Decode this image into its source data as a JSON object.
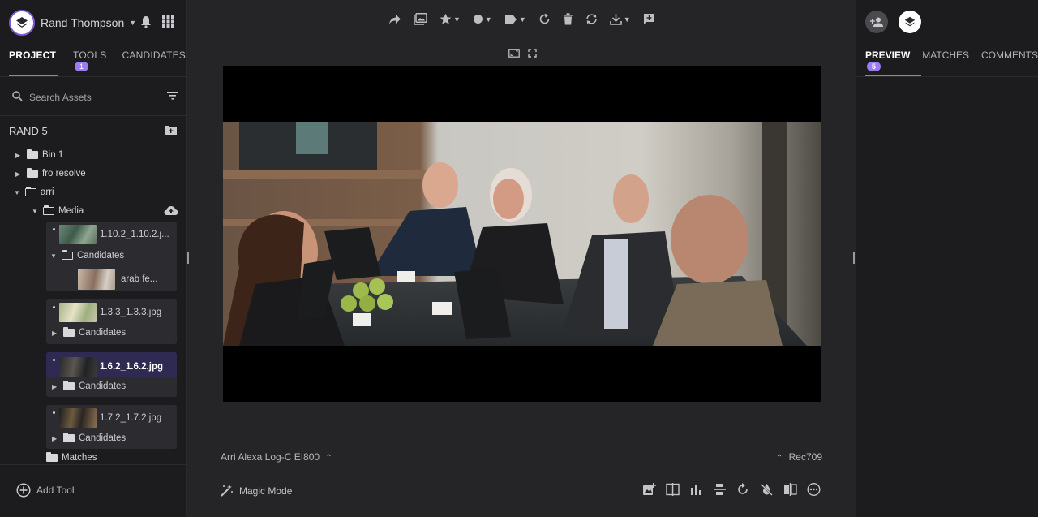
{
  "header": {
    "user_name": "Rand Thompson"
  },
  "left_tabs": [
    {
      "label": "PROJECT"
    },
    {
      "label": "TOOLS",
      "badge": "1"
    },
    {
      "label": "CANDIDATES"
    }
  ],
  "search": {
    "placeholder": "Search Assets"
  },
  "project": {
    "name": "RAND 5"
  },
  "tree": {
    "bin1": "Bin 1",
    "fro_resolve": "fro resolve",
    "arri": "arri",
    "media": "Media",
    "matches": "Matches"
  },
  "assets": [
    {
      "name": "1.10.2_1.10.2.j...",
      "candidates_label": "Candidates",
      "candidate_item": "arab fe..."
    },
    {
      "name": "1.3.3_1.3.3.jpg",
      "candidates_label": "Candidates"
    },
    {
      "name": "1.6.2_1.6.2.jpg",
      "candidates_label": "Candidates"
    },
    {
      "name": "1.7.2_1.7.2.jpg",
      "candidates_label": "Candidates"
    }
  ],
  "add_tool": "Add Tool",
  "viewer": {
    "input_color": "Arri Alexa Log-C EI800",
    "output_color": "Rec709",
    "magic_mode": "Magic Mode"
  },
  "right_tabs": [
    {
      "label": "PREVIEW",
      "badge": "5"
    },
    {
      "label": "MATCHES"
    },
    {
      "label": "COMMENTS"
    }
  ],
  "colors": {
    "accent": "#8f7be0",
    "badge": "#9c7cf0",
    "panel": "#1c1c1e",
    "center": "#252527"
  },
  "icons": [
    "bell-icon",
    "apps-grid-icon",
    "search-icon",
    "filter-icon",
    "new-folder-icon",
    "cloud-upload-icon",
    "share-icon",
    "gallery-icon",
    "star-icon",
    "circle-icon",
    "tag-icon",
    "reset-icon",
    "trash-icon",
    "sync-icon",
    "download-icon",
    "add-comment-icon",
    "fit-icon",
    "fullscreen-icon",
    "magic-wand-icon",
    "add-user-icon"
  ]
}
